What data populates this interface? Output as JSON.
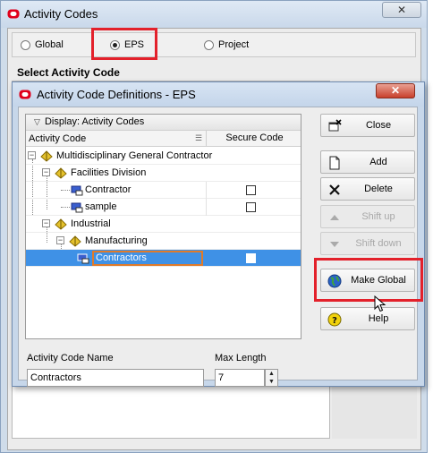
{
  "outer_window": {
    "title": "Activity Codes",
    "close_label": "✕",
    "scope_options": [
      {
        "label": "Global",
        "selected": false
      },
      {
        "label": "EPS",
        "selected": true
      },
      {
        "label": "Project",
        "selected": false
      }
    ],
    "select_label": "Select Activity Code"
  },
  "dialog": {
    "title": "Activity Code Definitions - EPS",
    "close_label": "✕",
    "display_label": "Display: Activity Codes",
    "columns": {
      "activity_code": "Activity Code",
      "secure_code": "Secure Code"
    },
    "tree": [
      {
        "label": "Multidisciplinary General Contractor",
        "level": 0,
        "type": "node",
        "expanded": true,
        "secure": null,
        "selected": false
      },
      {
        "label": "Facilities Division",
        "level": 1,
        "type": "node",
        "expanded": true,
        "secure": null,
        "selected": false
      },
      {
        "label": "Contractor",
        "level": 2,
        "type": "code",
        "secure": false,
        "selected": false
      },
      {
        "label": "sample",
        "level": 2,
        "type": "code",
        "secure": false,
        "selected": false
      },
      {
        "label": "Industrial",
        "level": 1,
        "type": "node",
        "expanded": true,
        "secure": null,
        "selected": false
      },
      {
        "label": "Manufacturing",
        "level": 2,
        "type": "node",
        "expanded": true,
        "secure": null,
        "selected": false
      },
      {
        "label": "Contractors",
        "level": 3,
        "type": "code",
        "secure": false,
        "selected": true
      }
    ],
    "buttons": {
      "close": "Close",
      "add": "Add",
      "delete": "Delete",
      "shift_up": "Shift up",
      "shift_down": "Shift down",
      "make_global": "Make Global",
      "help": "Help"
    },
    "fields": {
      "name_label": "Activity Code Name",
      "name_value": "Contractors",
      "max_length_label": "Max Length",
      "max_length_value": "7"
    }
  },
  "colors": {
    "highlight_red": "#e3212b",
    "selection_blue": "#3f91e6",
    "window_frame": "#c7d7ea"
  }
}
